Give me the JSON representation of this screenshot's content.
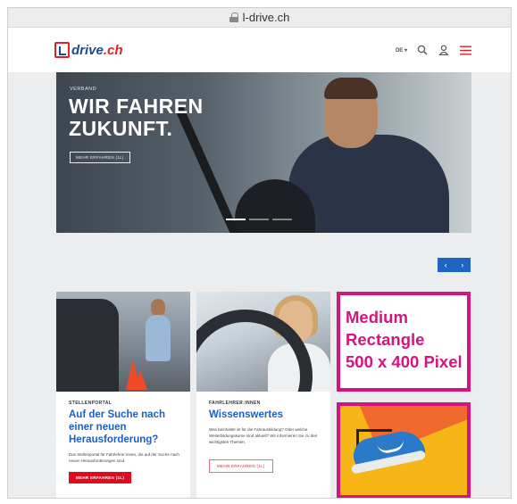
{
  "browser": {
    "url": "l-drive.ch"
  },
  "header": {
    "logo_text": "drive",
    "logo_tld": ".ch",
    "language": "DE",
    "icons": [
      "search-icon",
      "user-icon",
      "menu-icon"
    ]
  },
  "hero": {
    "eyebrow": "VERBAND",
    "headline_line1": "WIR FAHREN",
    "headline_line2": "ZUKUNFT.",
    "cta": "MEHR ERFAHREN (1L)",
    "active_slide": 1,
    "slide_count": 3
  },
  "slider_nav": {
    "prev": "‹",
    "next": "›"
  },
  "cards": [
    {
      "kicker": "STELLENPORTAL",
      "title": "Auf der Suche nach einer neuen Herausforderung?",
      "description": "Das Stellenportal für Fahrlehrer:innen, die auf der Suche nach neuen Herausforderungen sind.",
      "button": "MEHR ERFAHREN (1L)"
    },
    {
      "kicker": "FAHRLEHRER:INNEN",
      "title": "Wissenswertes",
      "description": "Was beinhaltet ist für die Fahrausbildung? Oder welche Weiterbildungskurse sind aktuell? Wir informieren Sie zu den wichtigsten Themen.",
      "button": "MEHR ERFAHREN (1L)"
    }
  ],
  "ads": {
    "medium_rectangle_line1": "Medium",
    "medium_rectangle_line2": "Rectangle",
    "medium_rectangle_line3": "500 x 400 Pixel"
  },
  "colors": {
    "brand_blue": "#1b5fc1",
    "brand_red": "#e0202b",
    "ad_border": "#d4157d",
    "ad_yellow": "#f6b618"
  }
}
